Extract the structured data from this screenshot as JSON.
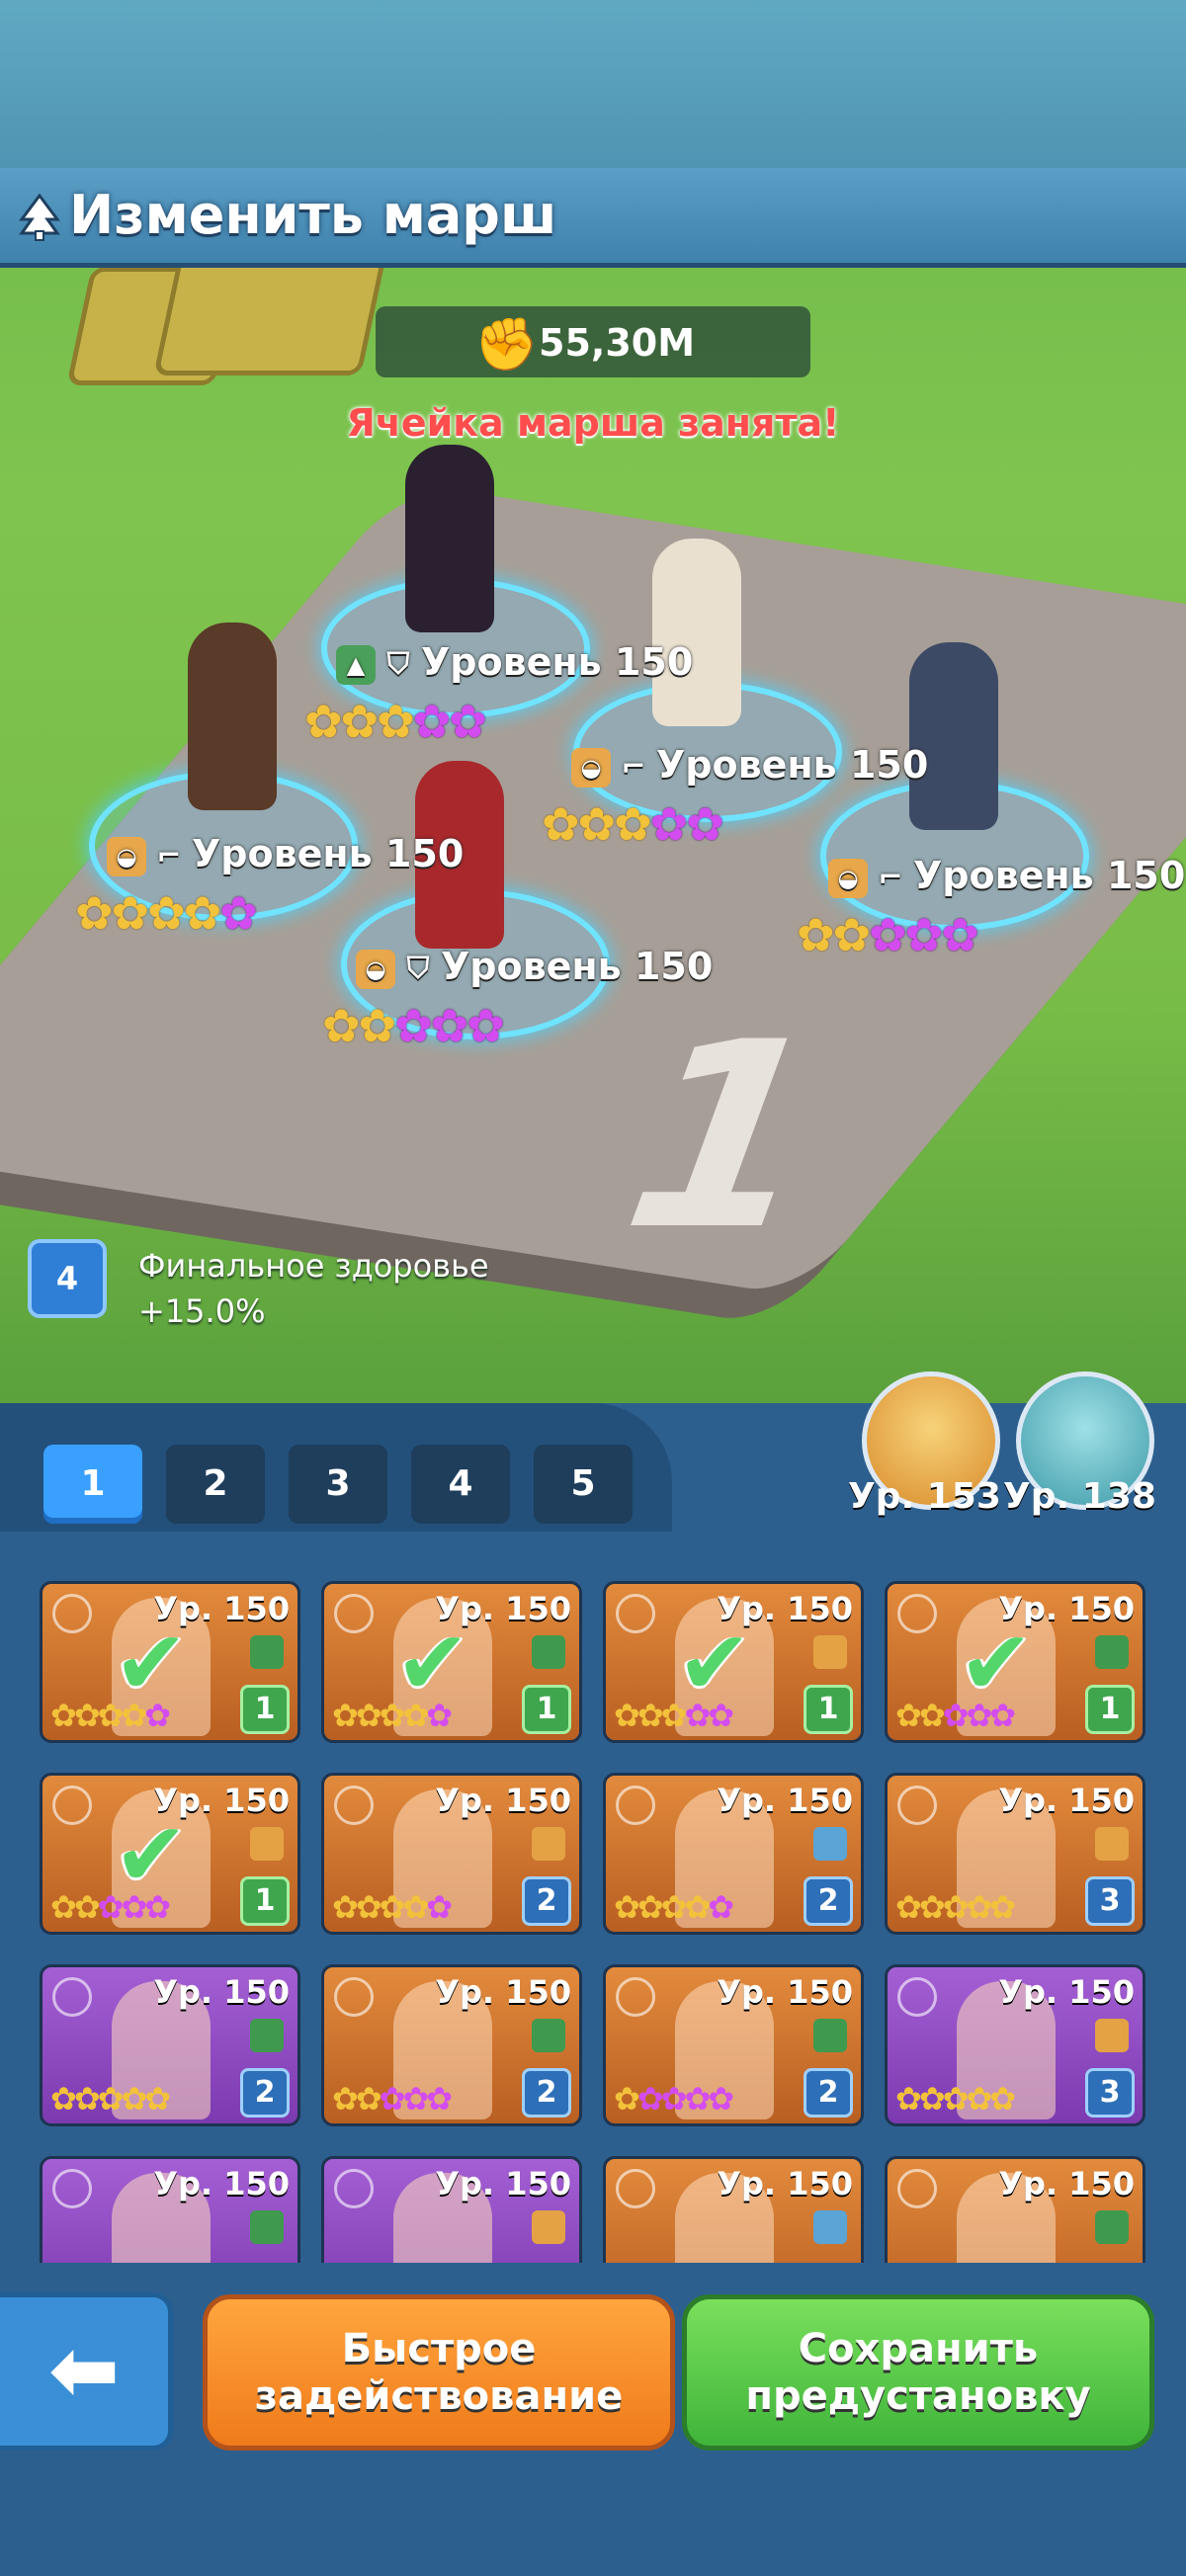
{
  "header": {
    "title": "Изменить марш"
  },
  "march": {
    "power": "55,30M",
    "warning": "Ячейка марша занята!",
    "slots": [
      {
        "level": "Уровень 150",
        "stars": [
          "g",
          "g",
          "g",
          "p",
          "p"
        ]
      },
      {
        "level": "Уровень 150",
        "stars": [
          "g",
          "g",
          "g",
          "p",
          "p"
        ]
      },
      {
        "level": "Уровень 150",
        "stars": [
          "g",
          "g",
          "g",
          "g",
          "p"
        ]
      },
      {
        "level": "Уровень 150",
        "stars": [
          "g",
          "g",
          "p",
          "p",
          "p"
        ]
      },
      {
        "level": "Уровень 150",
        "stars": [
          "g",
          "g",
          "p",
          "p",
          "p"
        ]
      }
    ],
    "platform_number": "1"
  },
  "bonus": {
    "badge": "4",
    "label": "Финальное здоровье",
    "value": "+15.0%"
  },
  "tabs": [
    "1",
    "2",
    "3",
    "4",
    "5"
  ],
  "pets": [
    {
      "level": "Ур. 153"
    },
    {
      "level": "Ур. 138"
    }
  ],
  "roster": [
    {
      "level": "Ур. 150",
      "count": "1",
      "selected": true,
      "stars": "ggggp",
      "color": "or"
    },
    {
      "level": "Ур. 150",
      "count": "1",
      "selected": true,
      "stars": "ggggp",
      "color": "or"
    },
    {
      "level": "Ур. 150",
      "count": "1",
      "selected": true,
      "stars": "gggpp",
      "color": "or"
    },
    {
      "level": "Ур. 150",
      "count": "1",
      "selected": true,
      "stars": "ggppp",
      "color": "or"
    },
    {
      "level": "Ур. 150",
      "count": "1",
      "selected": true,
      "stars": "ggppp",
      "color": "or"
    },
    {
      "level": "Ур. 150",
      "count": "2",
      "selected": false,
      "stars": "ggggp",
      "color": "or"
    },
    {
      "level": "Ур. 150",
      "count": "2",
      "selected": false,
      "stars": "ggggp",
      "color": "or"
    },
    {
      "level": "Ур. 150",
      "count": "3",
      "selected": false,
      "stars": "ggggg",
      "color": "or"
    },
    {
      "level": "Ур. 150",
      "count": "2",
      "selected": false,
      "stars": "ggggg",
      "color": "pu"
    },
    {
      "level": "Ур. 150",
      "count": "2",
      "selected": false,
      "stars": "ggppp",
      "color": "or"
    },
    {
      "level": "Ур. 150",
      "count": "2",
      "selected": false,
      "stars": "gpppp",
      "color": "or"
    },
    {
      "level": "Ур. 150",
      "count": "3",
      "selected": false,
      "stars": "ggggg",
      "color": "pu"
    },
    {
      "level": "Ур. 150",
      "count": "",
      "selected": false,
      "stars": "",
      "color": "pu"
    },
    {
      "level": "Ур. 150",
      "count": "",
      "selected": false,
      "stars": "",
      "color": "pu"
    },
    {
      "level": "Ур. 150",
      "count": "",
      "selected": false,
      "stars": "",
      "color": "or"
    },
    {
      "level": "Ур. 150",
      "count": "",
      "selected": false,
      "stars": "",
      "color": "or"
    }
  ],
  "buttons": {
    "quick": "Быстрое\nзадействование",
    "save": "Сохранить\nпредустановку"
  },
  "colors": {
    "gold_star": "#f3c23b",
    "purple_star": "#d34cf0",
    "save": "#4cc43f",
    "quick": "#f58a25"
  }
}
